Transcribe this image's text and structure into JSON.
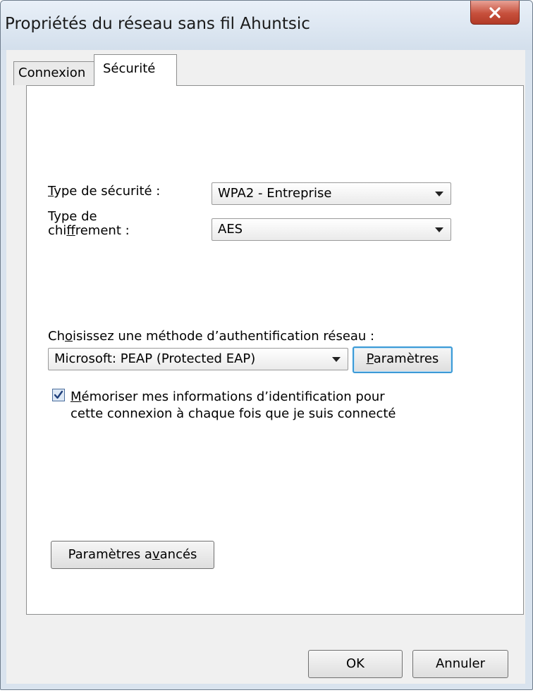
{
  "window": {
    "title": "Propriétés du réseau sans fil Ahuntsic",
    "close_icon": "close-icon"
  },
  "tabs": [
    {
      "label": "Connexion",
      "active": false
    },
    {
      "label": "Sécurité",
      "active": true
    }
  ],
  "security": {
    "type_label_pre": "",
    "type_label_u": "T",
    "type_label_post": "ype de sécurité :",
    "type_value": "WPA2 - Entreprise",
    "cipher_label_line1": "Type de",
    "cipher_label_pre": "chi",
    "cipher_label_u": "f",
    "cipher_label_post": "frement :",
    "cipher_value": "AES"
  },
  "auth": {
    "label_pre": "Ch",
    "label_u": "o",
    "label_post": "isissez une méthode d’authentification réseau :",
    "method_value": "Microsoft: PEAP (Protected EAP)",
    "params_button_u": "P",
    "params_button_rest": "aramètres",
    "remember_checked": true,
    "remember_line1_u": "M",
    "remember_line1_rest": "émoriser mes informations d’identification pour",
    "remember_line2": "cette connexion à chaque fois que je suis connecté"
  },
  "advanced": {
    "label_pre": "Paramètres a",
    "label_u": "v",
    "label_post": "ancés"
  },
  "footer": {
    "ok_label": "OK",
    "cancel_label": "Annuler"
  }
}
